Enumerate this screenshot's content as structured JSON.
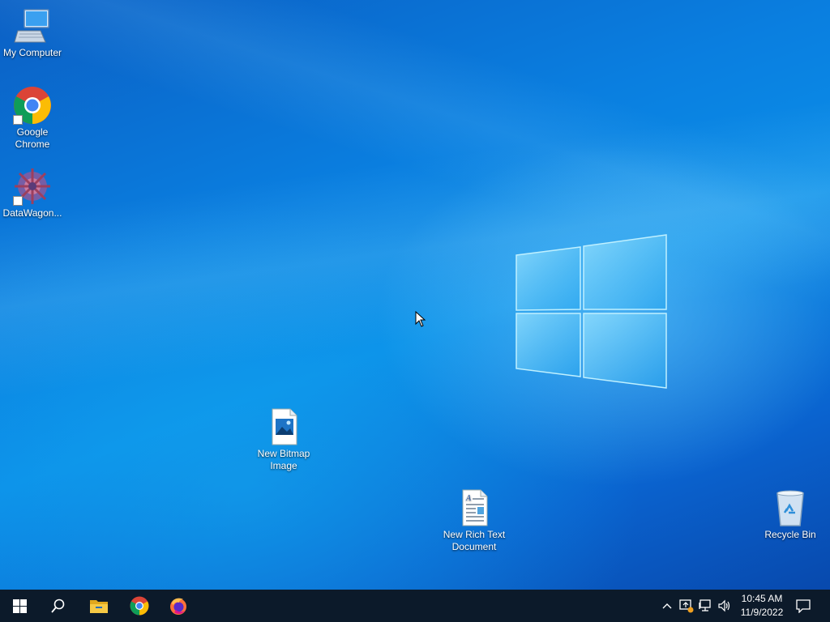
{
  "desktop": {
    "icons": {
      "my_computer": "My Computer",
      "google_chrome": "Google Chrome",
      "datawagon": "DataWagon...",
      "new_bitmap": "New Bitmap Image",
      "new_rich_text": "New Rich Text Document",
      "recycle_bin": "Recycle Bin"
    }
  },
  "taskbar": {
    "start": "start-icon",
    "search": "search-icon",
    "pinned": [
      "file-explorer-icon",
      "chrome-icon",
      "firefox-icon"
    ],
    "tray": [
      "chevron-up-icon",
      "app-update-icon",
      "network-icon",
      "volume-icon"
    ],
    "clock": {
      "time": "10:45 AM",
      "date": "11/9/2022"
    },
    "notifications": "notification-icon"
  },
  "colors": {
    "taskbar_bg": "#0c1a2a",
    "desktop_accent": "#0a78d7"
  }
}
